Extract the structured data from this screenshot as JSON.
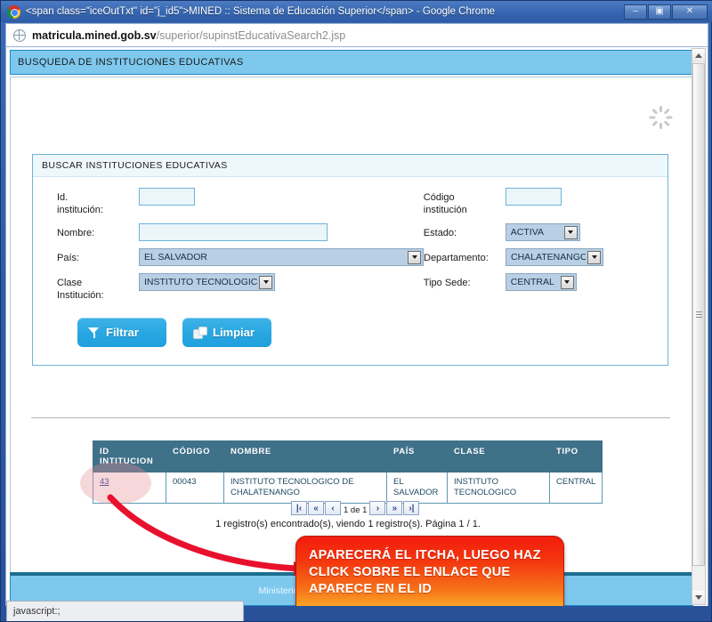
{
  "window": {
    "title": "<span class=\"iceOutTxt\" id=\"j_id5\">MINED :: Sistema de Educación Superior</span> - Google Chrome",
    "minimize_label": "–",
    "maximize_label": "▣",
    "close_label": "✕"
  },
  "urlbar": {
    "host": "matricula.mined.gob.sv",
    "path": "/superior/supinstEducativaSearch2.jsp"
  },
  "page": {
    "header_title": "BUSQUEDA DE INSTITUCIONES EDUCATIVAS",
    "footer_text": "Ministerio de Educacion de El Salvador 2008"
  },
  "panel": {
    "title": "BUSCAR INSTITUCIONES EDUCATIVAS",
    "fields": {
      "id_institucion": {
        "label": "Id.\ninstitución:",
        "value": ""
      },
      "codigo_institucion": {
        "label": "Código\ninstitución",
        "value": ""
      },
      "nombre": {
        "label": "Nombre:",
        "value": ""
      },
      "estado": {
        "label": "Estado:",
        "value": "ACTIVA"
      },
      "pais": {
        "label": "País:",
        "value": "EL SALVADOR"
      },
      "departamento": {
        "label": "Departamento:",
        "value": "CHALATENANGO"
      },
      "clase_institucion": {
        "label": "Clase\nInstitución:",
        "value": "INSTITUTO TECNOLOGICO"
      },
      "tipo_sede": {
        "label": "Tipo Sede:",
        "value": "CENTRAL"
      }
    },
    "buttons": {
      "filtrar": "Filtrar",
      "limpiar": "Limpiar"
    }
  },
  "results": {
    "columns": [
      "ID\nINTITUCION",
      "CÓDIGO",
      "NOMBRE",
      "PAÍS",
      "CLASE",
      "TIPO"
    ],
    "rows": [
      {
        "id": "43",
        "codigo": "00043",
        "nombre": "INSTITUTO TECNOLOGICO DE CHALATENANGO",
        "pais": "EL SALVADOR",
        "clase": "INSTITUTO TECNOLOGICO",
        "tipo": "CENTRAL"
      }
    ],
    "pager": {
      "first": "|‹",
      "prev_page": "«",
      "prev": "‹",
      "position": "1 de 1",
      "next": "›",
      "next_page": "»",
      "last": "›|"
    },
    "count_text": "1 registro(s) encontrado(s), viendo 1 registro(s). Página 1 / 1."
  },
  "annotation": {
    "callout_text": "APARECERÁ EL ITCHA, LUEGO HAZ\nCLICK SOBRE EL ENLACE QUE\nAPARECE EN EL ID"
  },
  "statusbar": {
    "text": "javascript:;"
  },
  "colors": {
    "accent_blue": "#7ec8ee",
    "panel_border": "#6db4d8",
    "table_header": "#3f7189",
    "button_blue": "#29a7e1",
    "callout_red": "#f41b0d",
    "callout_yellow": "#fdd93e",
    "link_blue": "#25408f"
  }
}
